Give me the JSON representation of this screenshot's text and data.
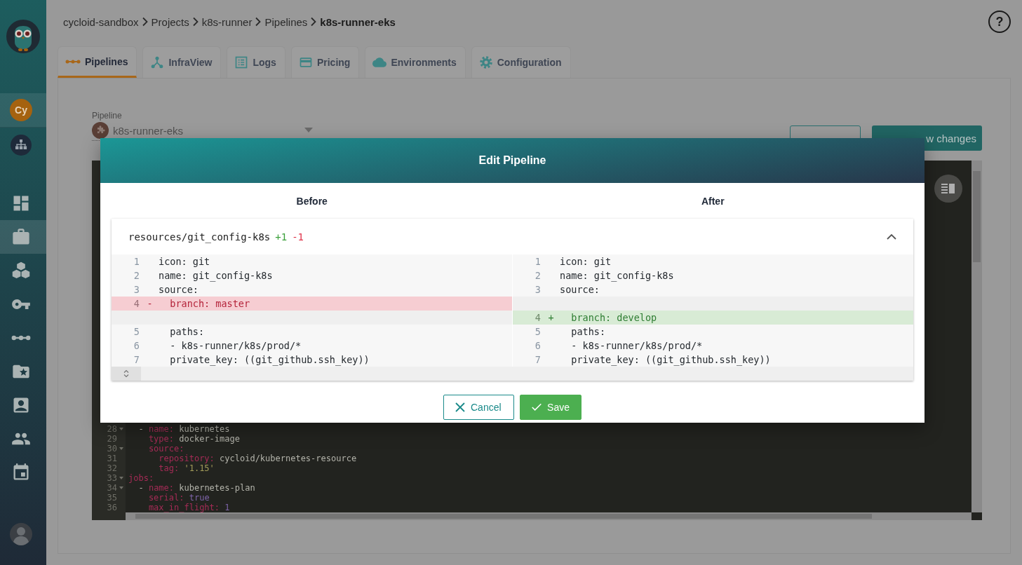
{
  "sidebar": {
    "org_initials": "Cy",
    "nav": [
      {
        "kind": "dashboard",
        "selected": false
      },
      {
        "kind": "briefcase",
        "selected": true
      },
      {
        "kind": "cubes",
        "selected": false
      },
      {
        "kind": "key",
        "selected": false
      },
      {
        "kind": "pipeline",
        "selected": false
      },
      {
        "kind": "folder-star",
        "selected": false
      },
      {
        "kind": "contact",
        "selected": false
      },
      {
        "kind": "people",
        "selected": false
      },
      {
        "kind": "calendar",
        "selected": false
      }
    ]
  },
  "breadcrumb": [
    {
      "label": "cycloid-sandbox",
      "current": false
    },
    {
      "label": "Projects",
      "current": false
    },
    {
      "label": "k8s-runner",
      "current": false
    },
    {
      "label": "Pipelines",
      "current": false
    },
    {
      "label": "k8s-runner-eks",
      "current": true
    }
  ],
  "help": {
    "label": "?"
  },
  "tabs": [
    {
      "kind": "pipelines",
      "label": "Pipelines",
      "selected": true
    },
    {
      "kind": "infraview",
      "label": "InfraView",
      "selected": false
    },
    {
      "kind": "logs",
      "label": "Logs",
      "selected": false
    },
    {
      "kind": "pricing",
      "label": "Pricing",
      "selected": false
    },
    {
      "kind": "environments",
      "label": "Environments",
      "selected": false
    },
    {
      "kind": "configuration",
      "label": "Configuration",
      "selected": false
    }
  ],
  "pipeline_select": {
    "label": "Pipeline",
    "value": "k8s-runner-eks"
  },
  "actions": [
    {
      "kind": "outlined"
    },
    {
      "kind": "primary",
      "label": "w changes"
    }
  ],
  "editor": {
    "lines": [
      {
        "number": "28",
        "fold": true,
        "segments": [
          {
            "kind": "plain",
            "text": "  - "
          },
          {
            "kind": "key",
            "text": "name:"
          },
          {
            "kind": "plain",
            "text": " kubernetes"
          }
        ]
      },
      {
        "number": "29",
        "fold": false,
        "segments": [
          {
            "kind": "key",
            "text": "    type:"
          },
          {
            "kind": "plain",
            "text": " docker-image"
          }
        ]
      },
      {
        "number": "30",
        "fold": true,
        "segments": [
          {
            "kind": "key",
            "text": "    source:"
          }
        ]
      },
      {
        "number": "31",
        "fold": false,
        "segments": [
          {
            "kind": "key",
            "text": "      repository:"
          },
          {
            "kind": "plain",
            "text": " cycloid/kubernetes-resource"
          }
        ]
      },
      {
        "number": "32",
        "fold": false,
        "segments": [
          {
            "kind": "key",
            "text": "      tag:"
          },
          {
            "kind": "string",
            "text": " '1.15'"
          }
        ]
      },
      {
        "number": "33",
        "fold": true,
        "segments": [
          {
            "kind": "key",
            "text": "jobs:"
          }
        ]
      },
      {
        "number": "34",
        "fold": true,
        "segments": [
          {
            "kind": "plain",
            "text": "  - "
          },
          {
            "kind": "key",
            "text": "name:"
          },
          {
            "kind": "plain",
            "text": " kubernetes-plan"
          }
        ]
      },
      {
        "number": "35",
        "fold": false,
        "segments": [
          {
            "kind": "key",
            "text": "    serial:"
          },
          {
            "kind": "bool",
            "text": " true"
          }
        ]
      },
      {
        "number": "36",
        "fold": false,
        "segments": [
          {
            "kind": "key",
            "text": "    max_in_flight:"
          },
          {
            "kind": "number",
            "text": " 1"
          }
        ]
      }
    ]
  },
  "modal": {
    "title": "Edit Pipeline",
    "columns": [
      "Before",
      "After"
    ],
    "file": {
      "path": "resources/git_config-k8s",
      "added": "+1",
      "removed": "-1",
      "expanded": true
    },
    "left": [
      {
        "kind": "context",
        "number": "1",
        "text": "icon: git"
      },
      {
        "kind": "context",
        "number": "2",
        "text": "name: git_config-k8s"
      },
      {
        "kind": "context",
        "number": "3",
        "text": "source:"
      },
      {
        "kind": "removed",
        "number": "4",
        "marker": "-",
        "text": "  branch: master"
      },
      {
        "kind": "empty"
      },
      {
        "kind": "context",
        "number": "5",
        "text": "  paths:"
      },
      {
        "kind": "context",
        "number": "6",
        "text": "  - k8s-runner/k8s/prod/*"
      },
      {
        "kind": "context",
        "number": "7",
        "text": "  private_key: ((git_github.ssh_key))"
      }
    ],
    "right": [
      {
        "kind": "context",
        "number": "1",
        "text": "icon: git"
      },
      {
        "kind": "context",
        "number": "2",
        "text": "name: git_config-k8s"
      },
      {
        "kind": "context",
        "number": "3",
        "text": "source:"
      },
      {
        "kind": "empty"
      },
      {
        "kind": "added",
        "number": "4",
        "marker": "+",
        "text": "  branch: develop"
      },
      {
        "kind": "context",
        "number": "5",
        "text": "  paths:"
      },
      {
        "kind": "context",
        "number": "6",
        "text": "  - k8s-runner/k8s/prod/*"
      },
      {
        "kind": "context",
        "number": "7",
        "text": "  private_key: ((git_github.ssh_key))"
      }
    ],
    "buttons": [
      {
        "kind": "cancel",
        "label": "Cancel"
      },
      {
        "kind": "save",
        "label": "Save"
      }
    ]
  }
}
